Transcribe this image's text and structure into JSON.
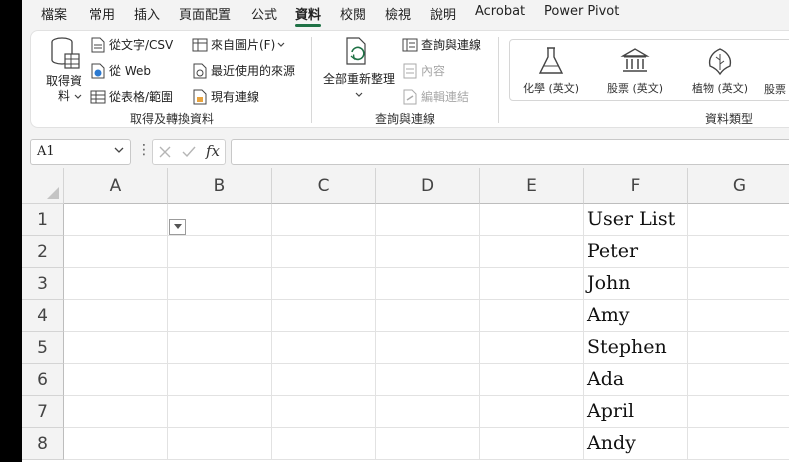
{
  "menu": {
    "tabs": [
      "檔案",
      "常用",
      "插入",
      "頁面配置",
      "公式",
      "資料",
      "校閱",
      "檢視",
      "說明",
      "Acrobat",
      "Power Pivot"
    ],
    "active": "資料"
  },
  "ribbon": {
    "get_transform": {
      "get_data": "取得資料",
      "from_text_csv": "從文字/CSV",
      "from_web": "從 Web",
      "from_table_range": "從表格/範圍",
      "from_picture": "來自圖片(F)",
      "recent_sources": "最近使用的來源",
      "existing_connections": "現有連線",
      "label": "取得及轉換資料"
    },
    "queries": {
      "refresh_all": "全部重新整理",
      "queries_connections": "查詢與連線",
      "properties": "內容",
      "edit_links": "編輯連結",
      "label": "查詢與連線"
    },
    "data_types": {
      "chemistry": "化學 (英文)",
      "stocks": "股票 (英文)",
      "plants": "植物 (英文)",
      "partial": "股票",
      "label": "資料類型"
    }
  },
  "formula_bar": {
    "name_box": "A1",
    "fx": "fx",
    "formula": ""
  },
  "sheet": {
    "columns": [
      "A",
      "B",
      "C",
      "D",
      "E",
      "F",
      "G"
    ],
    "rows": [
      "1",
      "2",
      "3",
      "4",
      "5",
      "6",
      "7",
      "8"
    ],
    "column_f": [
      "User List",
      "Peter",
      "John",
      "Amy",
      "Stephen",
      "Ada",
      "April",
      "Andy"
    ]
  },
  "colors": {
    "accent": "#1e7145"
  }
}
